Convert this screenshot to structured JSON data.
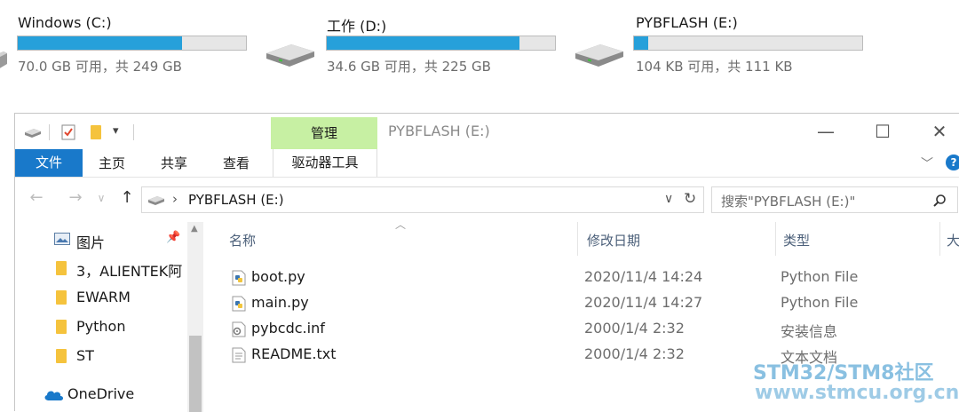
{
  "drives": [
    {
      "name": "Windows (C:)",
      "space": "70.0 GB 可用，共 249 GB",
      "used_fraction": 0.72,
      "icon": "hard-drive-icon"
    },
    {
      "name": "工作 (D:)",
      "space": "34.6 GB 可用，共 225 GB",
      "used_fraction": 0.846,
      "icon": "hard-drive-icon"
    },
    {
      "name": "PYBFLASH (E:)",
      "space": "104 KB 可用，共 111 KB",
      "used_fraction": 0.063,
      "icon": "hard-drive-icon"
    }
  ],
  "window": {
    "title": "PYBFLASH (E:)",
    "context_tab": "管理",
    "ribbon_tabs": [
      "文件",
      "主页",
      "共享",
      "查看",
      "驱动器工具"
    ],
    "controls": {
      "minimize": "—",
      "maximize": "☐",
      "close": "✕"
    }
  },
  "address": {
    "path": "PYBFLASH (E:)",
    "separator": "›"
  },
  "search": {
    "placeholder": "搜索\"PYBFLASH (E:)\""
  },
  "sidebar": {
    "items": [
      {
        "label": "图片",
        "icon": "pictures-icon",
        "pinned": true
      },
      {
        "label": "3，ALIENTEK阿",
        "icon": "folder-icon"
      },
      {
        "label": "EWARM",
        "icon": "folder-icon"
      },
      {
        "label": "Python",
        "icon": "folder-icon"
      },
      {
        "label": "ST",
        "icon": "folder-icon"
      },
      {
        "label": "OneDrive",
        "icon": "onedrive-icon"
      }
    ]
  },
  "columns": [
    "名称",
    "修改日期",
    "类型",
    "大"
  ],
  "files": [
    {
      "name": "boot.py",
      "modified": "2020/11/4 14:24",
      "type": "Python File",
      "icon": "python-file-icon"
    },
    {
      "name": "main.py",
      "modified": "2020/11/4 14:27",
      "type": "Python File",
      "icon": "python-file-icon"
    },
    {
      "name": "pybcdc.inf",
      "modified": "2000/1/4 2:32",
      "type": "安装信息",
      "icon": "inf-file-icon"
    },
    {
      "name": "README.txt",
      "modified": "2000/1/4 2:32",
      "type": "文本文档",
      "icon": "text-file-icon"
    }
  ],
  "watermark": {
    "line1": "STM32/STM8社区",
    "line2": "www.stmcu.org.cn"
  },
  "colors": {
    "accent": "#1979ca",
    "drive_fill": "#26a0da",
    "context_tab": "#c7f0a3"
  }
}
